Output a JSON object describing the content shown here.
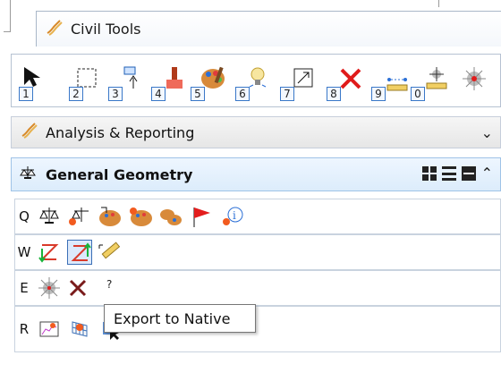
{
  "workflow": {
    "title": "Civil Tools"
  },
  "toolbar": {
    "tools": [
      {
        "icon": "select-arrow-icon",
        "num": "1"
      },
      {
        "icon": "fence-rect-icon",
        "num": "2"
      },
      {
        "icon": "move-icon",
        "num": "3"
      },
      {
        "icon": "place-element-icon",
        "num": "4"
      },
      {
        "icon": "palette-icon",
        "num": "5"
      },
      {
        "icon": "light-bulb-icon",
        "num": "6"
      },
      {
        "icon": "scale-icon",
        "num": "7"
      },
      {
        "icon": "delete-x-icon",
        "num": "8"
      },
      {
        "icon": "measure-distance-icon",
        "num": "9"
      },
      {
        "icon": "measure-ruler-icon",
        "num": "0"
      },
      {
        "icon": "target-icon",
        "num": ""
      }
    ]
  },
  "analysis": {
    "label": "Analysis & Reporting"
  },
  "geometry": {
    "label": "General Geometry"
  },
  "rows": [
    {
      "key": "Q",
      "icons": [
        "balance-icon",
        "balance-star-icon",
        "palette-edit-icon",
        "palette-star-icon",
        "palette-group-icon",
        "red-flag-icon",
        "info-icon"
      ]
    },
    {
      "key": "W",
      "icons": [
        "z-curve-down-icon",
        "z-curve-up-icon",
        "ruler-edit-icon"
      ]
    },
    {
      "key": "E",
      "icons": [
        "sun-target-icon",
        "cut-icon",
        "help-icon"
      ]
    },
    {
      "key": "R",
      "icons": [
        "graph-star-icon",
        "grid-star-icon",
        "select-grid-icon"
      ]
    }
  ],
  "tooltip": {
    "text": "Export to Native"
  },
  "colors": {
    "accent": "#3b6fb6",
    "header_bg": "#dcecfb"
  }
}
